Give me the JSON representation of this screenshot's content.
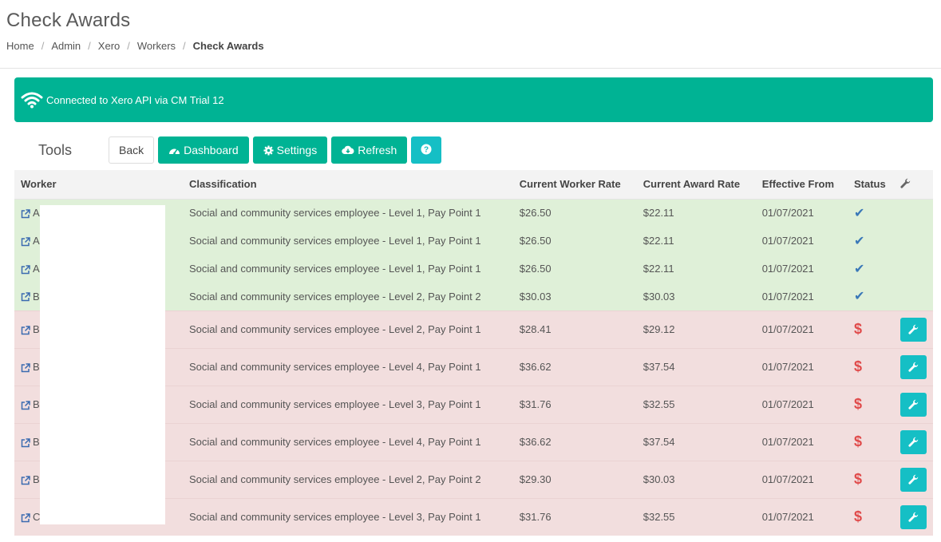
{
  "page": {
    "title": "Check Awards",
    "breadcrumb": [
      "Home",
      "Admin",
      "Xero",
      "Workers",
      "Check Awards"
    ]
  },
  "connection": {
    "text": "Connected to Xero API via CM Trial 12",
    "icon": "wifi-icon"
  },
  "tools": {
    "label": "Tools",
    "back": "Back",
    "dashboard": "Dashboard",
    "settings": "Settings",
    "refresh": "Refresh"
  },
  "table": {
    "headers": {
      "worker": "Worker",
      "classification": "Classification",
      "current_worker_rate": "Current Worker Rate",
      "current_award_rate": "Current Award Rate",
      "effective_from": "Effective From",
      "status": "Status"
    },
    "rows": [
      {
        "worker": "A",
        "classification": "Social and community services employee - Level 1, Pay Point 1",
        "worker_rate": "$26.50",
        "award_rate": "$22.11",
        "effective": "01/07/2021",
        "status": "ok"
      },
      {
        "worker": "A",
        "classification": "Social and community services employee - Level 1, Pay Point 1",
        "worker_rate": "$26.50",
        "award_rate": "$22.11",
        "effective": "01/07/2021",
        "status": "ok"
      },
      {
        "worker": "A",
        "classification": "Social and community services employee - Level 1, Pay Point 1",
        "worker_rate": "$26.50",
        "award_rate": "$22.11",
        "effective": "01/07/2021",
        "status": "ok"
      },
      {
        "worker": "B",
        "classification": "Social and community services employee - Level 2, Pay Point 2",
        "worker_rate": "$30.03",
        "award_rate": "$30.03",
        "effective": "01/07/2021",
        "status": "ok"
      },
      {
        "worker": "B",
        "classification": "Social and community services employee - Level 2, Pay Point 1",
        "worker_rate": "$28.41",
        "award_rate": "$29.12",
        "effective": "01/07/2021",
        "status": "underpaid"
      },
      {
        "worker": "B",
        "classification": "Social and community services employee - Level 4, Pay Point 1",
        "worker_rate": "$36.62",
        "award_rate": "$37.54",
        "effective": "01/07/2021",
        "status": "underpaid"
      },
      {
        "worker": "B",
        "classification": "Social and community services employee - Level 3, Pay Point 1",
        "worker_rate": "$31.76",
        "award_rate": "$32.55",
        "effective": "01/07/2021",
        "status": "underpaid"
      },
      {
        "worker": "B",
        "classification": "Social and community services employee - Level 4, Pay Point 1",
        "worker_rate": "$36.62",
        "award_rate": "$37.54",
        "effective": "01/07/2021",
        "status": "underpaid"
      },
      {
        "worker": "B",
        "classification": "Social and community services employee - Level 2, Pay Point 2",
        "worker_rate": "$29.30",
        "award_rate": "$30.03",
        "effective": "01/07/2021",
        "status": "underpaid"
      },
      {
        "worker": "C",
        "classification": "Social and community services employee - Level 3, Pay Point 1",
        "worker_rate": "$31.76",
        "award_rate": "$32.55",
        "effective": "01/07/2021",
        "status": "underpaid"
      }
    ],
    "status_symbols": {
      "ok": "✔",
      "underpaid": "$"
    }
  },
  "colors": {
    "accent": "#00b394",
    "cyan": "#15bfc5",
    "ok_row": "#dff0d8",
    "bad_row": "#f2dede"
  }
}
